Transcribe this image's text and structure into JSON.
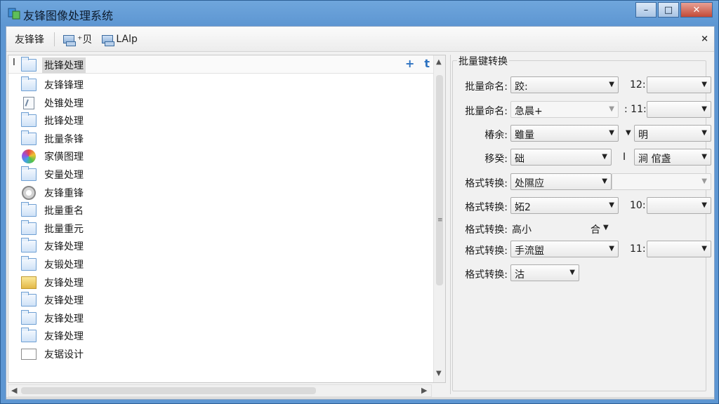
{
  "window": {
    "title": "友锋图像处理系统",
    "minimize_glyph": "–",
    "maximize_glyph": "□",
    "close_glyph": "✕"
  },
  "toolbar": {
    "brand_label": "友锋锋",
    "item1_label": "⁺贝",
    "item2_label": "LAlp",
    "panel_close_glyph": "×"
  },
  "tree": {
    "header_caret": "I",
    "add_glyph": "+",
    "sort_glyph": "t",
    "items": [
      {
        "icon": "folder-icon",
        "label": "批锋处理"
      },
      {
        "icon": "folder-icon",
        "label": "友锋锋理"
      },
      {
        "icon": "document-icon",
        "label": "处锥处理"
      },
      {
        "icon": "folder-icon",
        "label": "批锋处理"
      },
      {
        "icon": "folder-icon",
        "label": "批量条锋"
      },
      {
        "icon": "color-wheel-icon",
        "label": "家僙图理"
      },
      {
        "icon": "folder-icon",
        "label": "安量处理"
      },
      {
        "icon": "gear-icon",
        "label": "友锋重锋"
      },
      {
        "icon": "folder-icon",
        "label": "批量重名"
      },
      {
        "icon": "folder-icon",
        "label": "批量重元"
      },
      {
        "icon": "folder-icon",
        "label": "友锋处理"
      },
      {
        "icon": "folder-icon",
        "label": "友锻处理"
      },
      {
        "icon": "yellow-folder-icon",
        "label": "友锋处理"
      },
      {
        "icon": "folder-icon",
        "label": "友锋处理"
      },
      {
        "icon": "folder-icon",
        "label": "友锋处理"
      },
      {
        "icon": "folder-icon",
        "label": "友锋处理"
      },
      {
        "icon": "blank-file-icon",
        "label": "友锯设计"
      }
    ]
  },
  "settings": {
    "group_title": "批量键转换",
    "rows": [
      {
        "label": "批量命名:",
        "value": "跤:",
        "extra_label": "12:",
        "extra_value": ""
      },
      {
        "label": "批量命名:",
        "value": "急晨+",
        "extra_label": ": 11:",
        "extra_value": ""
      },
      {
        "label": "椿余:",
        "value": "雖量",
        "extra_value": "明"
      },
      {
        "label": "移癸:",
        "value": "础",
        "extra_label": "I",
        "extra_value": "涧 倌盏"
      },
      {
        "label": "格式转换:",
        "value": "处隰应",
        "extra_value": ""
      },
      {
        "label": "格式转换:",
        "value": "妬2",
        "extra_label": "10:",
        "extra_value": ""
      },
      {
        "label": "格式转换:",
        "value": "高小",
        "extra_value": "合"
      },
      {
        "label": "格式转换:",
        "value": "手流盥",
        "extra_label": "11:",
        "extra_value": ""
      },
      {
        "label": "格式转换:",
        "value": "沽"
      }
    ]
  }
}
